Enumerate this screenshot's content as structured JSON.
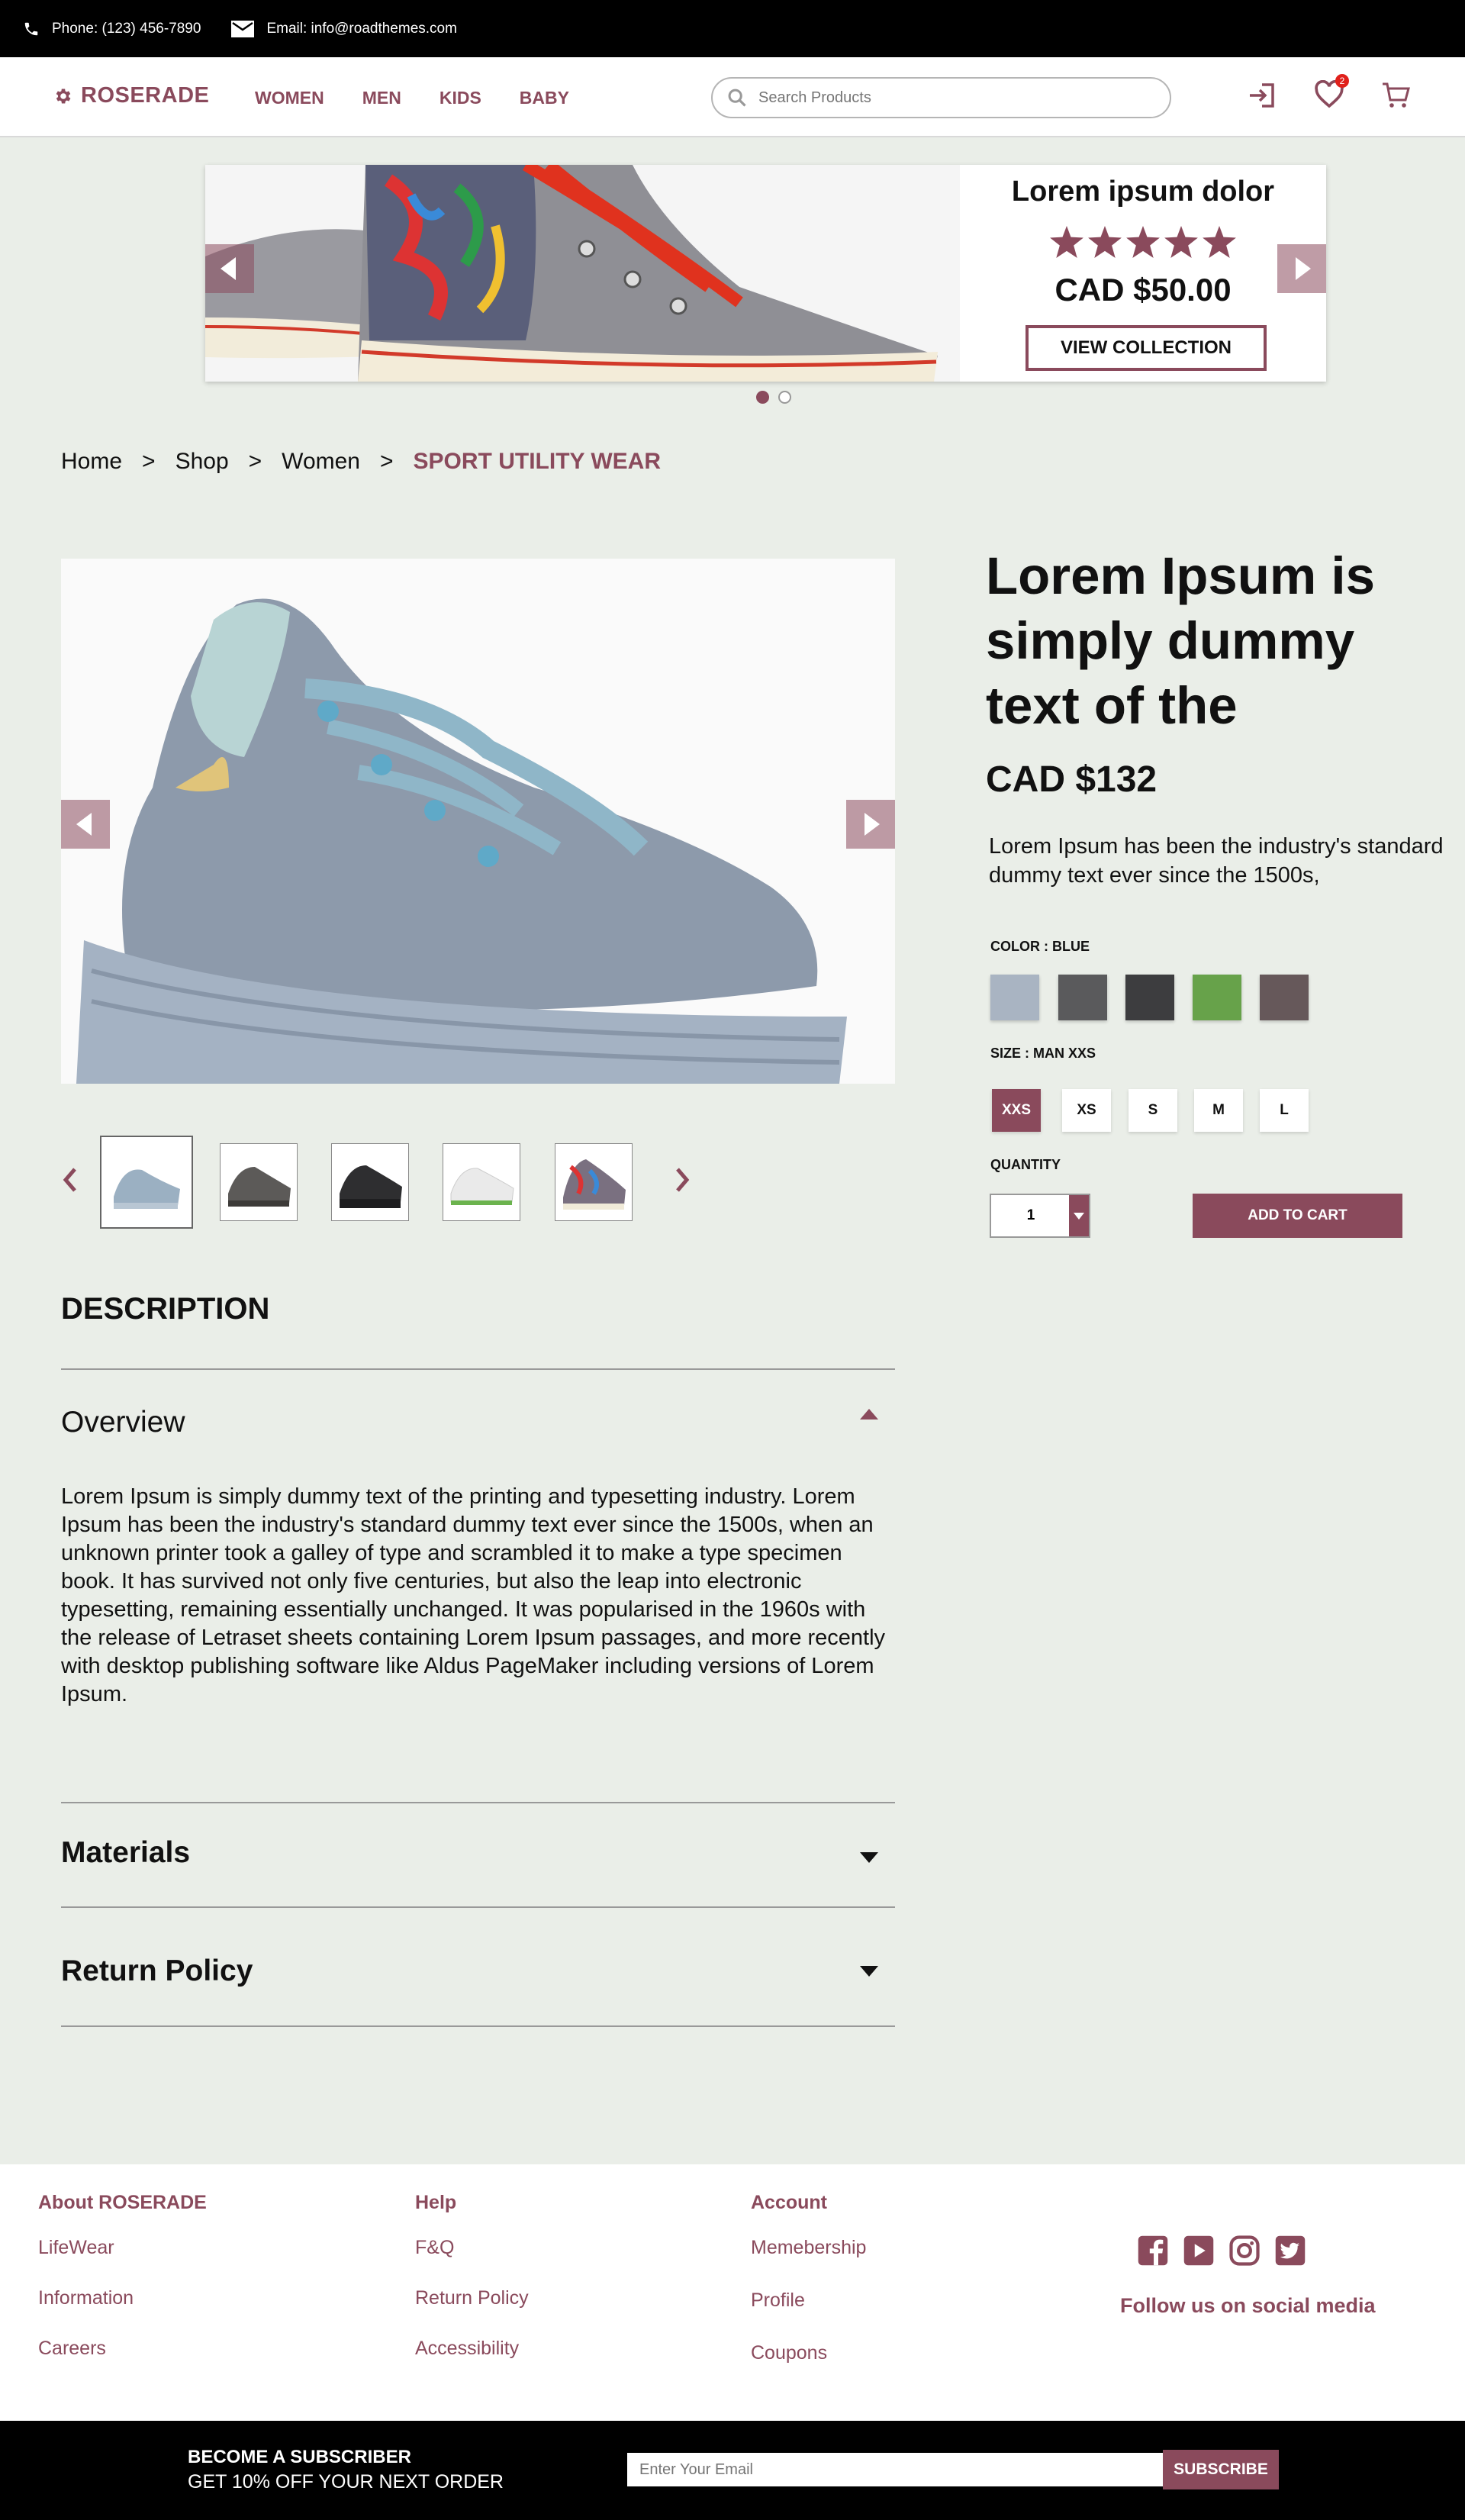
{
  "topbar": {
    "phone": "Phone: (123) 456-7890",
    "email": "Email: info@roadthemes.com"
  },
  "header": {
    "logo": "ROSERADE",
    "nav": [
      "WOMEN",
      "MEN",
      "KIDS",
      "BABY"
    ],
    "search_placeholder": "Search Products",
    "wishlist_count": "2"
  },
  "hero": {
    "title": "Lorem ipsum dolor",
    "rating": 5,
    "price": "CAD $50.00",
    "button": "VIEW COLLECTION"
  },
  "breadcrumb": {
    "items": [
      "Home",
      "Shop",
      "Women"
    ],
    "separator": ">",
    "current": "SPORT UTILITY WEAR"
  },
  "product": {
    "title": "Lorem Ipsum is simply dummy text of the",
    "price": "CAD $132",
    "description": "Lorem Ipsum has been the industry's standard dummy text ever since the 1500s,",
    "color_label": "COLOR : BLUE",
    "colors": [
      "#a9b4c2",
      "#5a5a5c",
      "#3d3d3f",
      "#67a24a",
      "#66585a"
    ],
    "size_label": "SIZE : MAN XXS",
    "sizes": [
      "XXS",
      "XS",
      "S",
      "M",
      "L"
    ],
    "selected_size": "XXS",
    "quantity_label": "QUANTITY",
    "quantity": "1",
    "add_to_cart": "ADD TO CART"
  },
  "description": {
    "heading": "DESCRIPTION",
    "overview_title": "Overview",
    "overview_text": "Lorem Ipsum is simply dummy text of the printing and typesetting industry. Lorem Ipsum has been the industry's standard dummy text ever since the 1500s, when an unknown printer took a galley of type and scrambled it to make a type specimen book. It has survived not only five centuries, but also the leap into electronic typesetting, remaining essentially unchanged. It was popularised in the 1960s with the release of Letraset sheets containing Lorem Ipsum passages, and more recently with desktop publishing software like Aldus PageMaker including versions of Lorem Ipsum.",
    "materials_title": "Materials",
    "return_title": "Return Policy"
  },
  "footer": {
    "about": {
      "heading": "About ROSERADE",
      "links": [
        "LifeWear",
        "Information",
        "Careers"
      ]
    },
    "help": {
      "heading": "Help",
      "links": [
        "F&Q",
        "Return Policy",
        "Accessibility"
      ]
    },
    "account": {
      "heading": "Account",
      "links": [
        "Memebership",
        "Profile",
        "Coupons"
      ]
    },
    "social_icons": [
      "facebook-icon",
      "youtube-icon",
      "instagram-icon",
      "twitter-icon"
    ],
    "follow": "Follow us on social media"
  },
  "subscribe": {
    "line1": "BECOME A SUBSCRIBER",
    "line2": "GET 10% OFF YOUR NEXT ORDER",
    "placeholder": "Enter Your Email",
    "button": "SUBSCRIBE"
  },
  "colors": {
    "accent": "#8a4a5c",
    "background": "#eaeee8"
  }
}
